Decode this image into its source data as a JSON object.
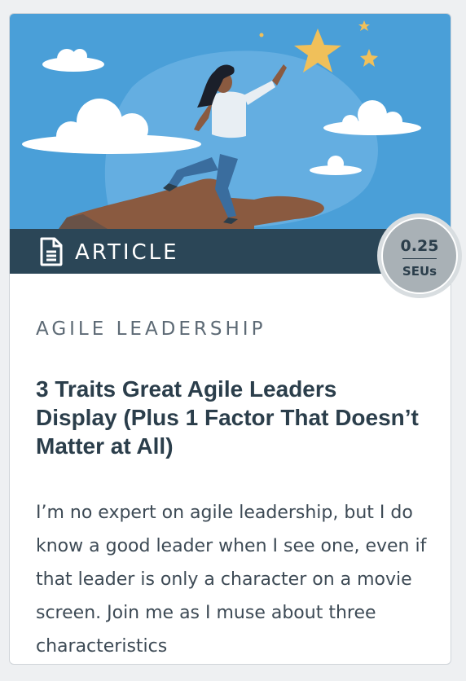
{
  "card": {
    "type_label": "ARTICLE",
    "type_icon": "document-icon",
    "badge": {
      "value": "0.25",
      "unit": "SEUs"
    },
    "category": "AGILE LEADERSHIP",
    "title": "3 Traits Great Agile Leaders Display (Plus 1 Factor That Doesn’t Matter at All)",
    "excerpt": "I’m no expert on agile leadership, but I do know a good leader when I see one, even if that leader is only a character on a movie screen. Join me as I muse about three characteristics"
  },
  "colors": {
    "hero_sky": "#4a9fd8",
    "type_bar": "#2b4657",
    "star": "#f0c05a",
    "badge": "#a9b1b6",
    "title_text": "#2b3e4b"
  }
}
